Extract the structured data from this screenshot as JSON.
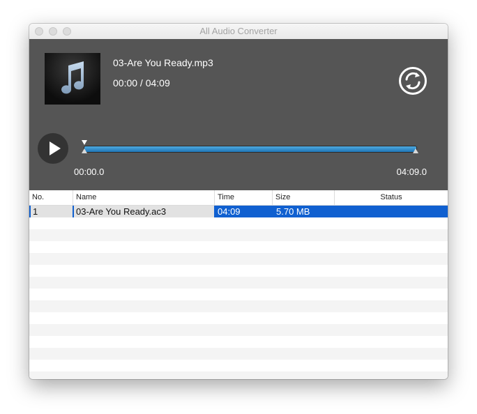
{
  "window": {
    "title": "All Audio Converter"
  },
  "player": {
    "file_name": "03-Are You Ready.mp3",
    "time_display": "00:00 / 04:09",
    "range_start": "00:00.0",
    "range_end": "04:09.0",
    "playback_progress": 0,
    "icons": {
      "album": "music-note-icon",
      "convert": "convert-arrows-icon",
      "play": "play-icon"
    },
    "colors": {
      "background": "#555555",
      "track": "#2f8fd0"
    }
  },
  "table": {
    "columns": [
      "No.",
      "Name",
      "Time",
      "Size",
      "Status"
    ],
    "rows": [
      {
        "no": "1",
        "name": "03-Are You Ready.ac3",
        "time": "04:09",
        "size": "5.70  MB",
        "status": ""
      }
    ],
    "selection_color": "#1060d0"
  }
}
